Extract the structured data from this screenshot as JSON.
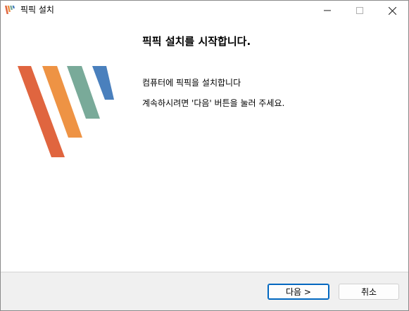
{
  "window": {
    "title": "픽픽 설치",
    "icon": "picpick-logo-icon"
  },
  "controls": {
    "minimize_icon": "minimize-icon",
    "maximize_icon": "maximize-icon",
    "close_icon": "close-icon"
  },
  "main": {
    "heading": "픽픽 설치를 시작합니다.",
    "line1": "컴퓨터에 픽픽을 설치합니다",
    "line2": "계속하시려면 '다음' 버튼을 눌러 주세요."
  },
  "footer": {
    "next_label": "다음 >",
    "cancel_label": "취소"
  },
  "colors": {
    "stripe_red": "#e0653f",
    "stripe_orange": "#ee9344",
    "stripe_green": "#79aa99",
    "stripe_blue": "#4a80bd",
    "accent": "#0067c0"
  }
}
